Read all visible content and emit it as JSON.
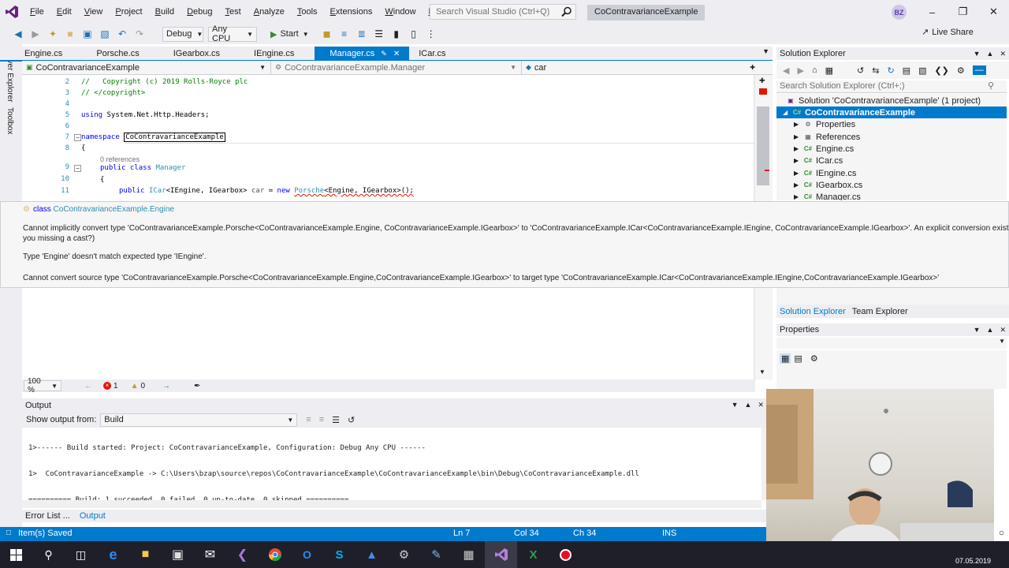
{
  "menubar": {
    "items": [
      "File",
      "Edit",
      "View",
      "Project",
      "Build",
      "Debug",
      "Test",
      "Analyze",
      "Tools",
      "Extensions",
      "Window",
      "Help"
    ],
    "search_placeholder": "Search Visual Studio (Ctrl+Q)",
    "window_title": "CoContravarianceExample",
    "avatar": "BZ"
  },
  "toolbar": {
    "config": "Debug",
    "platform": "Any CPU",
    "start_label": "Start",
    "live_share": "Live Share"
  },
  "tabs": [
    {
      "label": "Engine.cs",
      "active": false
    },
    {
      "label": "Porsche.cs",
      "active": false
    },
    {
      "label": "IGearbox.cs",
      "active": false
    },
    {
      "label": "IEngine.cs",
      "active": false
    },
    {
      "label": "Manager.cs",
      "active": true
    },
    {
      "label": "ICar.cs",
      "active": false
    }
  ],
  "navbar": {
    "project": "CoContravarianceExample",
    "type": "CoContravarianceExample.Manager",
    "member": "car"
  },
  "code": {
    "line_numbers": [
      "2",
      "3",
      "4",
      "5",
      "6",
      "7",
      "8",
      "9",
      "10",
      "11"
    ],
    "copyright": "//   Copyright (c) 2019 Rolls-Royce plc",
    "copyright_end": "// </copyright>",
    "using_kw": "using",
    "using_ns": "System.Net.Http.Headers;",
    "namespace_kw": "namespace",
    "namespace_name": "CoContravarianceExample",
    "brace_open": "{",
    "references": "0 references",
    "class_kw": "public class",
    "class_name": "Manager",
    "brace_open2": "{",
    "line11_kw": "public",
    "line11_type1": "ICar",
    "line11_rest1": "<IEngine, IGearbox>",
    "line11_var": "car",
    "line11_eq": "=",
    "line11_new": "new",
    "line11_type2": "Porsche",
    "line11_rest2": "<Engine, IGearbox>();"
  },
  "tooltip": {
    "kind": "class",
    "symbol": "CoContravarianceExample.Engine",
    "error1": "Cannot implicitly convert type 'CoContravarianceExample.Porsche<CoContravarianceExample.Engine, CoContravarianceExample.IGearbox>' to 'CoContravarianceExample.ICar<CoContravarianceExample.IEngine, CoContravarianceExample.IGearbox>'. An explicit conversion exists (are",
    "error1b": "you missing a cast?)",
    "error2": "Type 'Engine' doesn't match expected type 'IEngine'.",
    "error3": "Cannot convert source type 'CoContravarianceExample.Porsche<CoContravarianceExample.Engine,CoContravarianceExample.IGearbox>' to target type 'CoContravarianceExample.ICar<CoContravarianceExample.IEngine,CoContravarianceExample.IGearbox>'"
  },
  "editor_status": {
    "zoom": "100 %",
    "errors": "1",
    "warnings": "0"
  },
  "output": {
    "title": "Output",
    "show_from_label": "Show output from:",
    "source": "Build",
    "lines": [
      "1>------ Build started: Project: CoContravarianceExample, Configuration: Debug Any CPU ------",
      "1>  CoContravarianceExample -> C:\\Users\\bzap\\source\\repos\\CoContravarianceExample\\CoContravarianceExample\\bin\\Debug\\CoContravarianceExample.dll",
      "========== Build: 1 succeeded, 0 failed, 0 up-to-date, 0 skipped =========="
    ]
  },
  "bottom_tabs": [
    "Error List ...",
    "Output"
  ],
  "statusbar": {
    "message": "Item(s) Saved",
    "ln": "Ln 7",
    "col": "Col 34",
    "ch": "Ch 34",
    "mode": "INS"
  },
  "solution_explorer": {
    "title": "Solution Explorer",
    "search_placeholder": "Search Solution Explorer (Ctrl+;)",
    "solution": "Solution 'CoContravarianceExample' (1 project)",
    "project": "CoContravarianceExample",
    "items": [
      "Properties",
      "References",
      "Engine.cs",
      "ICar.cs",
      "IEngine.cs",
      "IGearbox.cs",
      "Manager.cs"
    ],
    "tabs": [
      "Solution Explorer",
      "Team Explorer"
    ]
  },
  "properties": {
    "title": "Properties"
  },
  "taskbar": {
    "date": "07.05.2019"
  },
  "colors": {
    "accent": "#007acc",
    "error": "#e51400",
    "chrome": "#eeeef2"
  }
}
